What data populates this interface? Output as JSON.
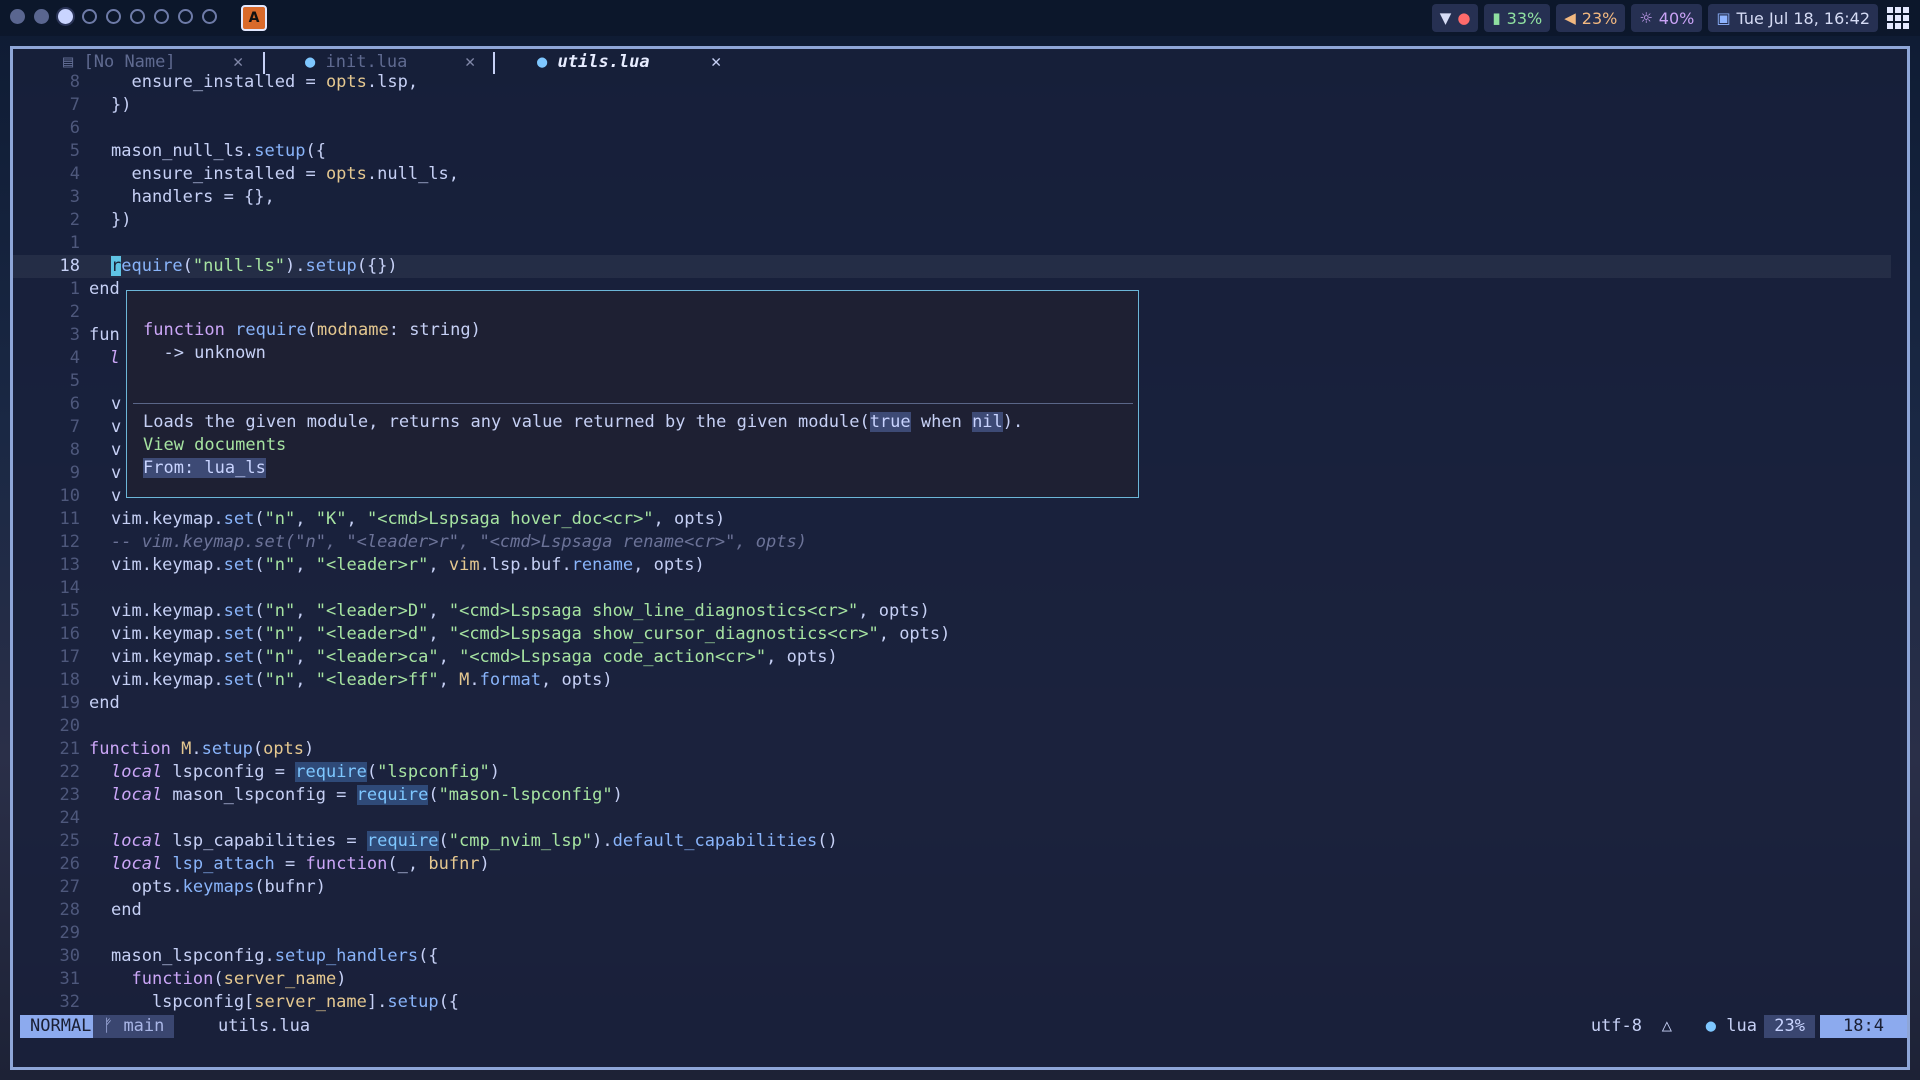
{
  "topbar": {
    "workspaces": [
      "filled",
      "filled",
      "active",
      "empty",
      "empty",
      "empty",
      "empty",
      "empty",
      "empty"
    ],
    "app_icon": "A",
    "tray": {
      "wifi_icon": "▼",
      "battery": "33%",
      "volume": "23%",
      "brightness": "40%",
      "datetime": "Tue Jul 18, 16:42"
    }
  },
  "tabs": [
    {
      "label": "[No Name]",
      "close": "✕"
    },
    {
      "label": "init.lua",
      "close": "✕"
    },
    {
      "label": "utils.lua",
      "close": "✕"
    }
  ],
  "hover": {
    "signature": "function require(modname: string)",
    "returns": "  -> unknown",
    "description_pre": "Loads the given module, returns any value returned by the given module(",
    "kw_true": "true",
    "when": " when ",
    "kw_nil": "nil",
    "description_post": ").",
    "link": "View documents",
    "source": "From: lua_ls"
  },
  "status": {
    "mode": "NORMAL",
    "branch": " main",
    "filename": "utils.lua",
    "encoding": "utf-8",
    "filetype": " lua",
    "percent": "23%",
    "position": "18:4"
  }
}
